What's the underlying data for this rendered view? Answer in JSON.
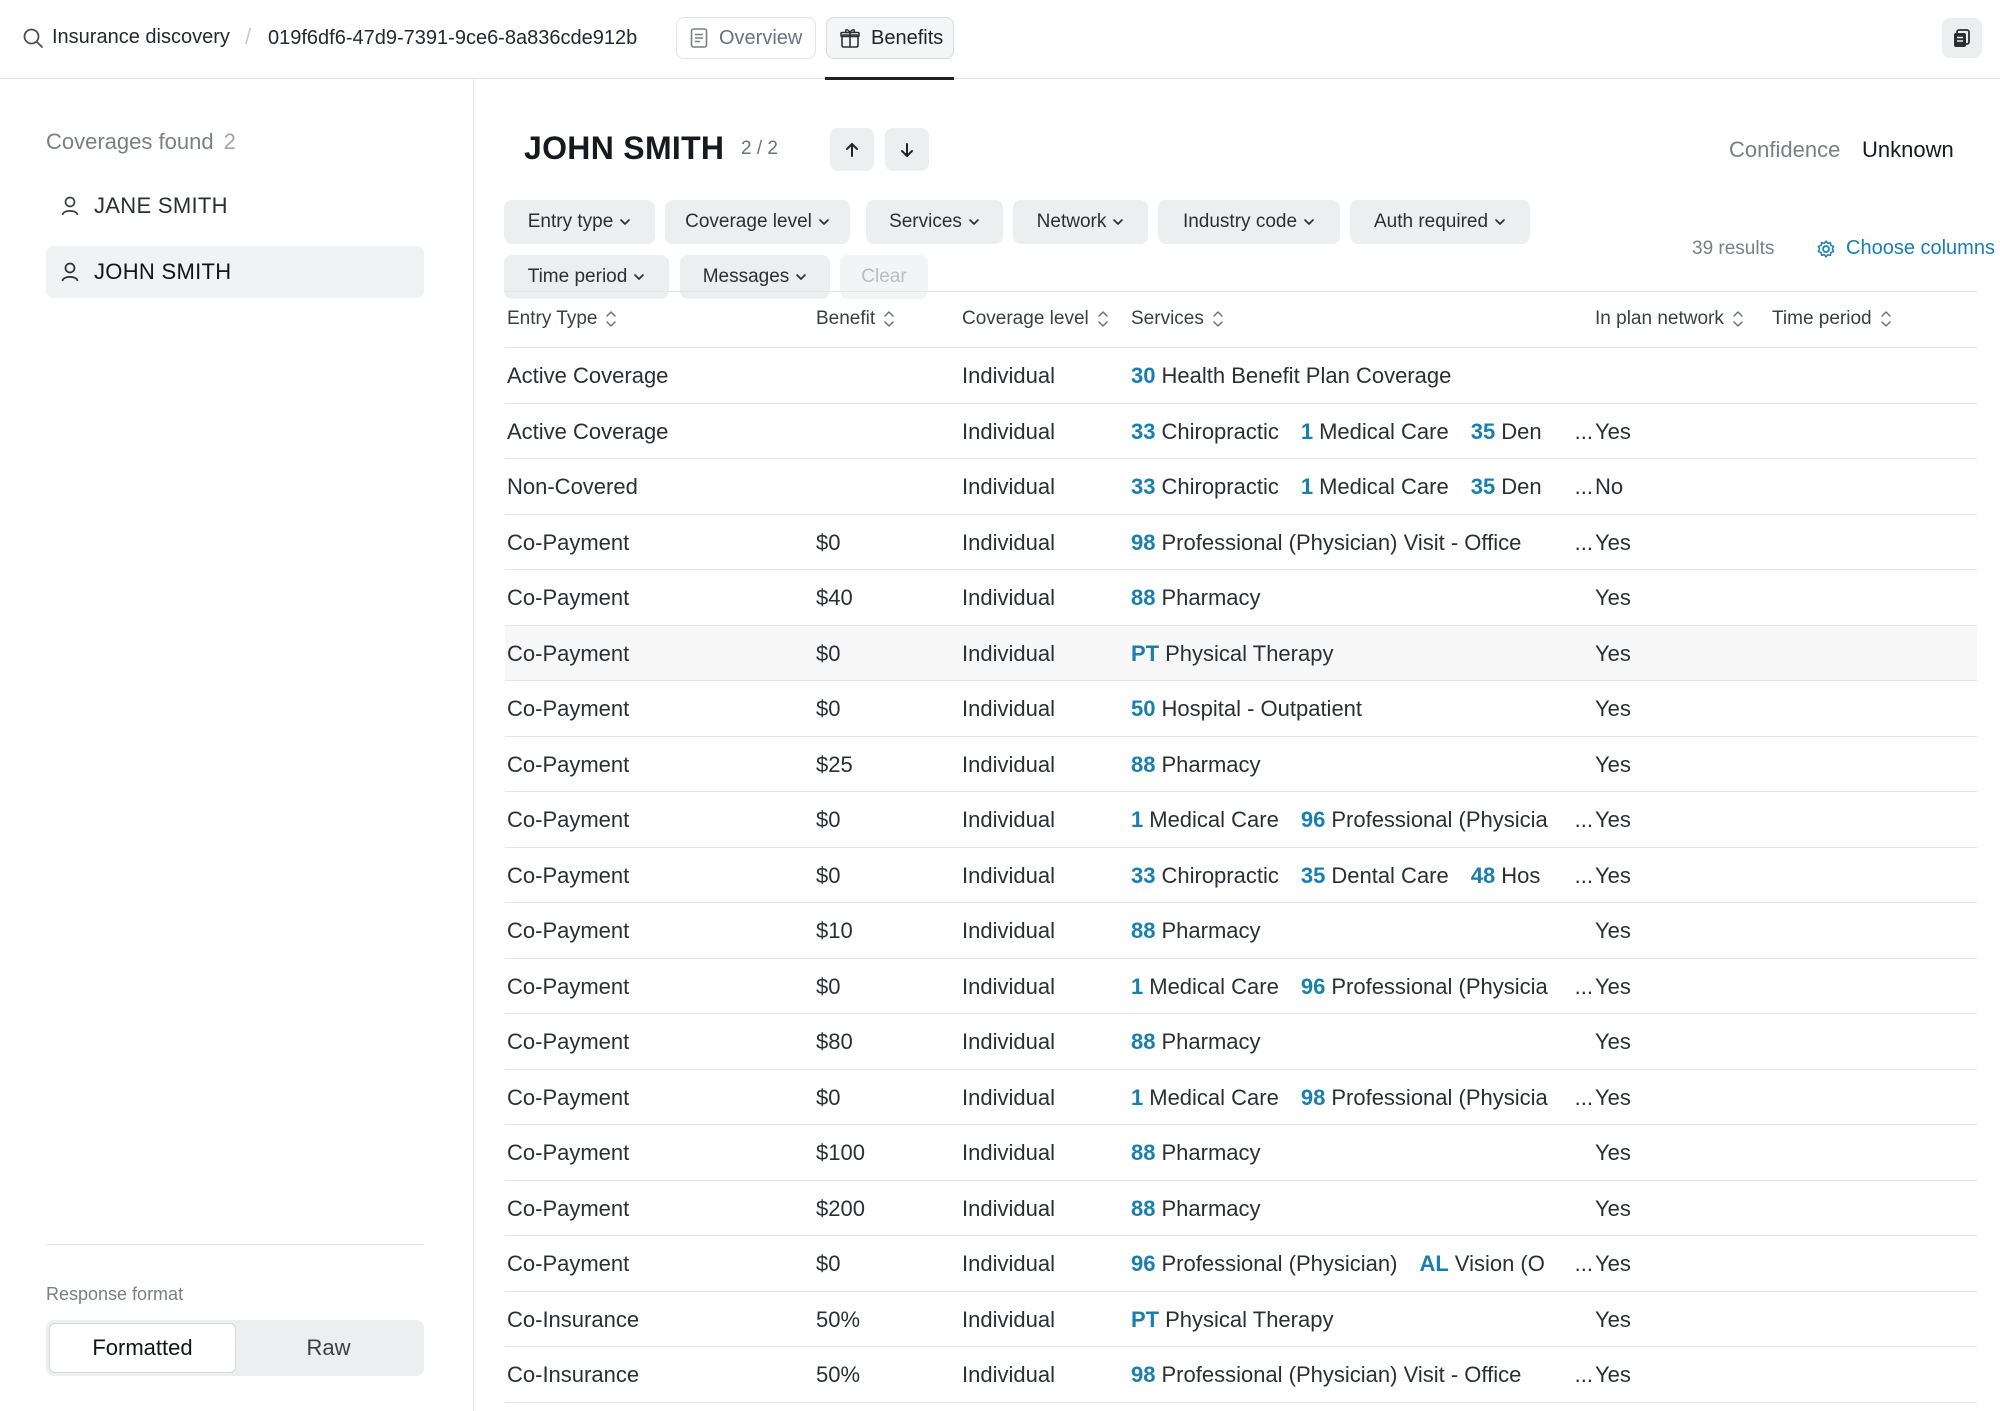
{
  "breadcrumb": {
    "search_label": "Insurance discovery",
    "separator": "/",
    "record_id": "019f6df6-47d9-7391-9ce6-8a836cde912b"
  },
  "top_tabs": [
    {
      "label": "Overview",
      "icon": "document-icon",
      "active": false
    },
    {
      "label": "Benefits",
      "icon": "gift-icon",
      "active": true
    }
  ],
  "sidebar": {
    "coverages_label": "Coverages found",
    "coverages_count": "2",
    "people": [
      {
        "name": "JANE SMITH",
        "active": false
      },
      {
        "name": "JOHN SMITH",
        "active": true
      }
    ],
    "response_format_label": "Response format",
    "formats": [
      {
        "label": "Formatted",
        "active": true
      },
      {
        "label": "Raw",
        "active": false
      }
    ]
  },
  "header": {
    "name": "JOHN SMITH",
    "pager": "2 / 2",
    "confidence_label": "Confidence",
    "confidence_value": "Unknown"
  },
  "filters": [
    "Entry type",
    "Coverage level",
    "Services",
    "Network",
    "Industry code",
    "Auth required",
    "Time period",
    "Messages"
  ],
  "clear_label": "Clear",
  "results_label": "39 results",
  "choose_columns_label": "Choose columns",
  "accent_color": "#1a7fae",
  "table": {
    "columns": [
      "Entry Type",
      "Benefit",
      "Coverage level",
      "Services",
      "In plan network",
      "Time period"
    ],
    "rows": [
      {
        "entry": "Active Coverage",
        "benefit": "",
        "level": "Individual",
        "services": [
          {
            "code": "30",
            "name": "Health Benefit Plan Coverage"
          }
        ],
        "truncated": false,
        "network": ""
      },
      {
        "entry": "Active Coverage",
        "benefit": "",
        "level": "Individual",
        "services": [
          {
            "code": "33",
            "name": "Chiropractic"
          },
          {
            "code": "1",
            "name": "Medical Care"
          },
          {
            "code": "35",
            "name": "Den"
          }
        ],
        "truncated": true,
        "network": "Yes"
      },
      {
        "entry": "Non-Covered",
        "benefit": "",
        "level": "Individual",
        "services": [
          {
            "code": "33",
            "name": "Chiropractic"
          },
          {
            "code": "1",
            "name": "Medical Care"
          },
          {
            "code": "35",
            "name": "Den"
          }
        ],
        "truncated": true,
        "network": "No"
      },
      {
        "entry": "Co-Payment",
        "benefit": "$0",
        "level": "Individual",
        "services": [
          {
            "code": "98",
            "name": "Professional (Physician) Visit - Office"
          }
        ],
        "truncated": true,
        "network": "Yes"
      },
      {
        "entry": "Co-Payment",
        "benefit": "$40",
        "level": "Individual",
        "services": [
          {
            "code": "88",
            "name": "Pharmacy"
          }
        ],
        "truncated": false,
        "network": "Yes"
      },
      {
        "entry": "Co-Payment",
        "benefit": "$0",
        "level": "Individual",
        "services": [
          {
            "code": "PT",
            "name": "Physical Therapy"
          }
        ],
        "truncated": false,
        "network": "Yes"
      },
      {
        "entry": "Co-Payment",
        "benefit": "$0",
        "level": "Individual",
        "services": [
          {
            "code": "50",
            "name": "Hospital - Outpatient"
          }
        ],
        "truncated": false,
        "network": "Yes"
      },
      {
        "entry": "Co-Payment",
        "benefit": "$25",
        "level": "Individual",
        "services": [
          {
            "code": "88",
            "name": "Pharmacy"
          }
        ],
        "truncated": false,
        "network": "Yes"
      },
      {
        "entry": "Co-Payment",
        "benefit": "$0",
        "level": "Individual",
        "services": [
          {
            "code": "1",
            "name": "Medical Care"
          },
          {
            "code": "96",
            "name": "Professional (Physicia"
          }
        ],
        "truncated": true,
        "network": "Yes"
      },
      {
        "entry": "Co-Payment",
        "benefit": "$0",
        "level": "Individual",
        "services": [
          {
            "code": "33",
            "name": "Chiropractic"
          },
          {
            "code": "35",
            "name": "Dental Care"
          },
          {
            "code": "48",
            "name": "Hos"
          }
        ],
        "truncated": true,
        "network": "Yes"
      },
      {
        "entry": "Co-Payment",
        "benefit": "$10",
        "level": "Individual",
        "services": [
          {
            "code": "88",
            "name": "Pharmacy"
          }
        ],
        "truncated": false,
        "network": "Yes"
      },
      {
        "entry": "Co-Payment",
        "benefit": "$0",
        "level": "Individual",
        "services": [
          {
            "code": "1",
            "name": "Medical Care"
          },
          {
            "code": "96",
            "name": "Professional (Physicia"
          }
        ],
        "truncated": true,
        "network": "Yes"
      },
      {
        "entry": "Co-Payment",
        "benefit": "$80",
        "level": "Individual",
        "services": [
          {
            "code": "88",
            "name": "Pharmacy"
          }
        ],
        "truncated": false,
        "network": "Yes"
      },
      {
        "entry": "Co-Payment",
        "benefit": "$0",
        "level": "Individual",
        "services": [
          {
            "code": "1",
            "name": "Medical Care"
          },
          {
            "code": "98",
            "name": "Professional (Physicia"
          }
        ],
        "truncated": true,
        "network": "Yes"
      },
      {
        "entry": "Co-Payment",
        "benefit": "$100",
        "level": "Individual",
        "services": [
          {
            "code": "88",
            "name": "Pharmacy"
          }
        ],
        "truncated": false,
        "network": "Yes"
      },
      {
        "entry": "Co-Payment",
        "benefit": "$200",
        "level": "Individual",
        "services": [
          {
            "code": "88",
            "name": "Pharmacy"
          }
        ],
        "truncated": false,
        "network": "Yes"
      },
      {
        "entry": "Co-Payment",
        "benefit": "$0",
        "level": "Individual",
        "services": [
          {
            "code": "96",
            "name": "Professional (Physician)"
          },
          {
            "code": "AL",
            "name": "Vision (O"
          }
        ],
        "truncated": true,
        "network": "Yes"
      },
      {
        "entry": "Co-Insurance",
        "benefit": "50%",
        "level": "Individual",
        "services": [
          {
            "code": "PT",
            "name": "Physical Therapy"
          }
        ],
        "truncated": false,
        "network": "Yes"
      },
      {
        "entry": "Co-Insurance",
        "benefit": "50%",
        "level": "Individual",
        "services": [
          {
            "code": "98",
            "name": "Professional (Physician) Visit - Office"
          }
        ],
        "truncated": true,
        "network": "Yes"
      }
    ]
  }
}
